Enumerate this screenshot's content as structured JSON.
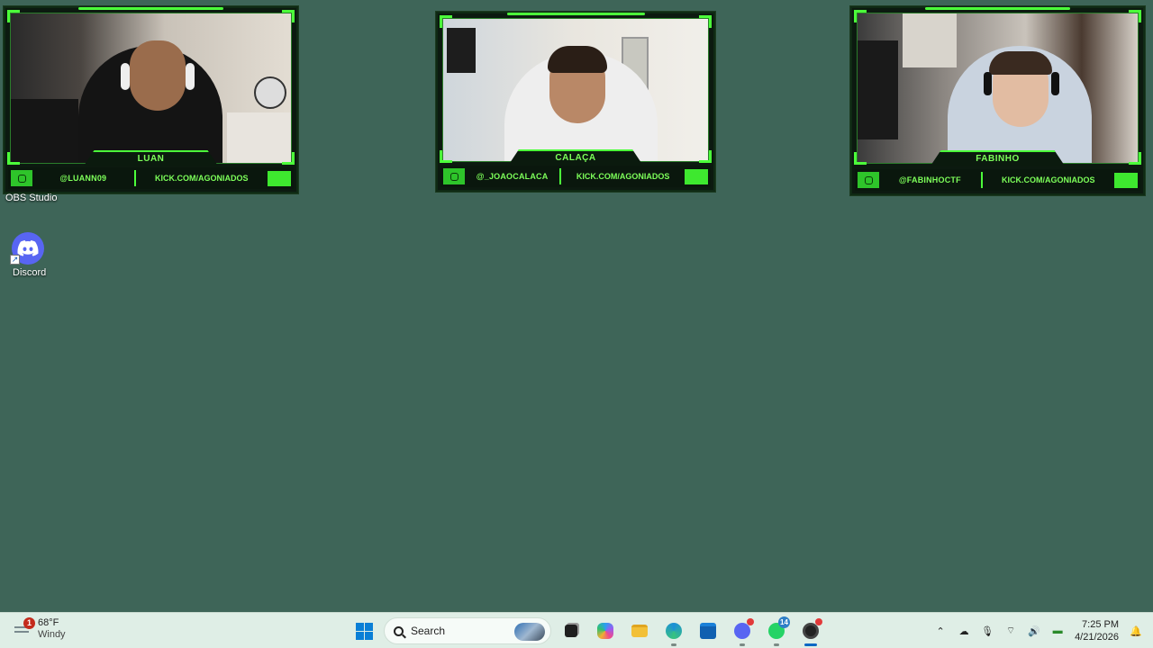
{
  "cams": [
    {
      "name": "LUAN",
      "handle": "@LUANN09",
      "link": "KICK.COM/AGONIADOS"
    },
    {
      "name": "CALAÇA",
      "handle": "@_JOAOCALACA",
      "link": "KICK.COM/AGONIADOS"
    },
    {
      "name": "FABINHO",
      "handle": "@FABINHOCTF",
      "link": "KICK.COM/AGONIADOS"
    }
  ],
  "desktop": {
    "obs_label": "OBS Studio",
    "discord_label": "Discord"
  },
  "taskbar": {
    "weather": {
      "temp": "68°F",
      "condition": "Windy",
      "badge": "1"
    },
    "search_label": "Search",
    "whatsapp_badge": "14",
    "time": "7:25 PM",
    "date": "4/21/2026"
  },
  "colors": {
    "desktop_bg": "#3e6558",
    "overlay_green": "#4cff3a",
    "taskbar_bg": "#dfeee6"
  }
}
